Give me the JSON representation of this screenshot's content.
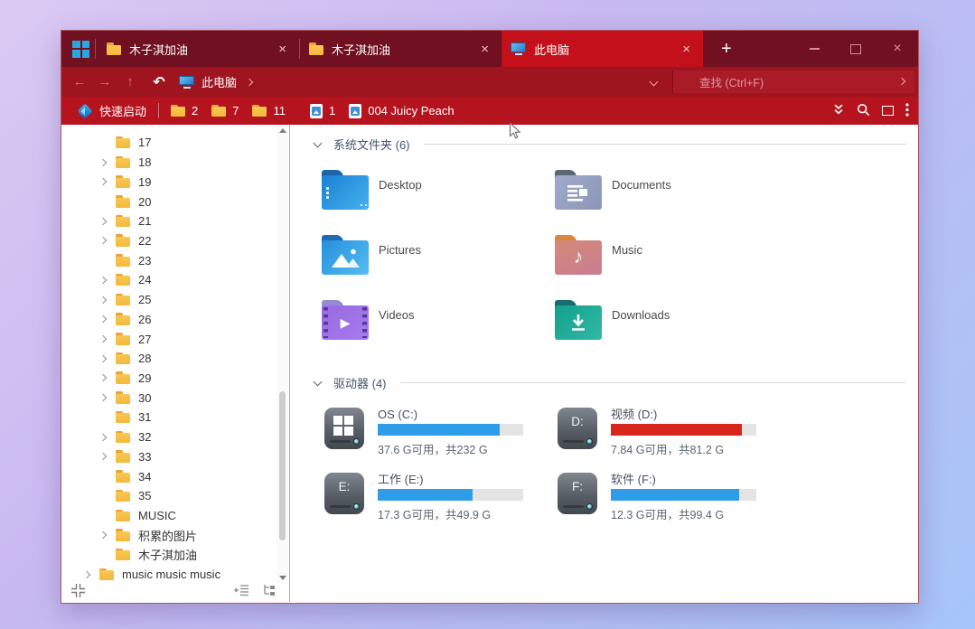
{
  "tab_bar": {
    "tabs": [
      {
        "label": "木子淇加油"
      },
      {
        "label": "木子淇加油"
      },
      {
        "label": "此电脑"
      }
    ],
    "close_glyph": "×",
    "new_tab_glyph": "+",
    "window_close_glyph": "×"
  },
  "address_bar": {
    "location": "此电脑"
  },
  "search": {
    "placeholder": "查找 (Ctrl+F)"
  },
  "toolbar": {
    "quick_launch_label": "快速启动",
    "items": [
      {
        "label": "2"
      },
      {
        "label": "7"
      },
      {
        "label": "11"
      },
      {
        "label": "1"
      },
      {
        "label": "004 Juicy Peach"
      }
    ]
  },
  "sidebar": {
    "items": [
      {
        "label": "17"
      },
      {
        "label": "18"
      },
      {
        "label": "19"
      },
      {
        "label": "20"
      },
      {
        "label": "21"
      },
      {
        "label": "22"
      },
      {
        "label": "23"
      },
      {
        "label": "24"
      },
      {
        "label": "25"
      },
      {
        "label": "26"
      },
      {
        "label": "27"
      },
      {
        "label": "28"
      },
      {
        "label": "29"
      },
      {
        "label": "30"
      },
      {
        "label": "31"
      },
      {
        "label": "32"
      },
      {
        "label": "33"
      },
      {
        "label": "34"
      },
      {
        "label": "35"
      },
      {
        "label": "MUSIC"
      },
      {
        "label": "积累的图片"
      },
      {
        "label": "木子淇加油"
      },
      {
        "label": "music  music  music"
      }
    ]
  },
  "main": {
    "sections": {
      "system_folders": {
        "title": "系统文件夹 (6)"
      },
      "drives": {
        "title": "驱动器 (4)"
      }
    },
    "folders": [
      {
        "name": "Desktop"
      },
      {
        "name": "Documents"
      },
      {
        "name": "Pictures"
      },
      {
        "name": "Music"
      },
      {
        "name": "Videos"
      },
      {
        "name": "Downloads"
      }
    ],
    "drives": [
      {
        "name": "OS (C:)",
        "info": "37.6 G可用，共232 G",
        "percent": 84,
        "color": "#2f9ce8"
      },
      {
        "name": "视频 (D:)",
        "info": "7.84 G可用，共81.2 G",
        "percent": 90,
        "color": "#d7261c",
        "letter": "D:"
      },
      {
        "name": "工作 (E:)",
        "info": "17.3 G可用，共49.9 G",
        "percent": 65,
        "color": "#2f9ce8",
        "letter": "E:"
      },
      {
        "name": "软件 (F:)",
        "info": "12.3 G可用，共99.4 G",
        "percent": 88,
        "color": "#2f9ce8",
        "letter": "F:"
      }
    ],
    "music_note_glyph": "♪",
    "play_glyph": "▶"
  }
}
